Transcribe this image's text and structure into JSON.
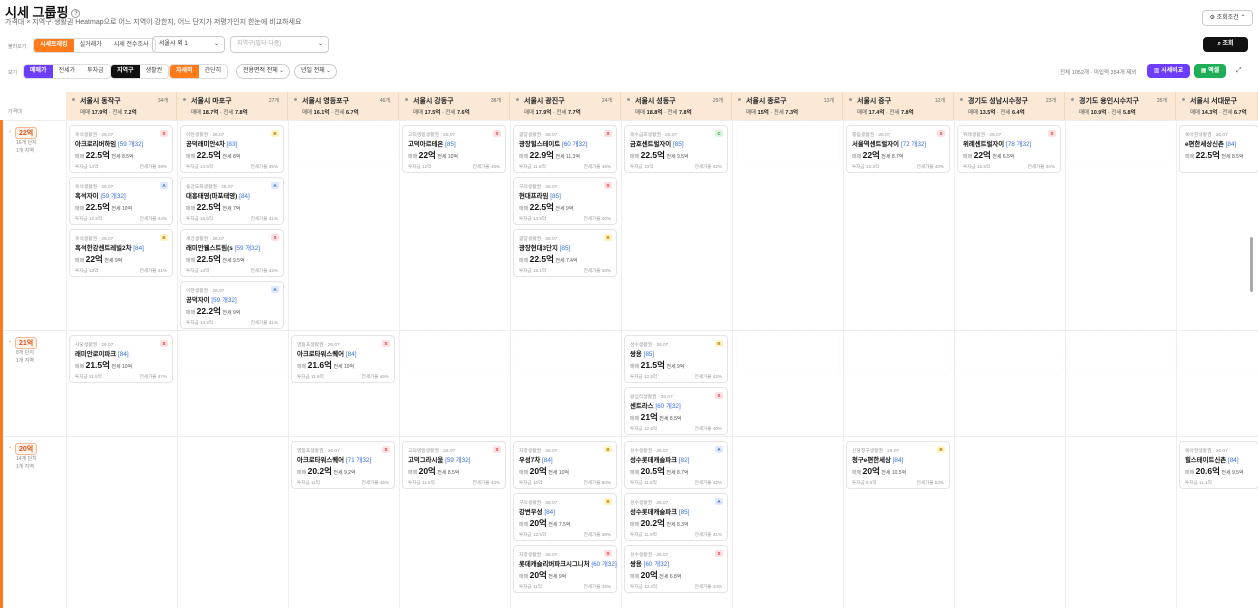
{
  "header": {
    "title": "시세 그룹핑",
    "subtitle": "가격대 × 지역구·생활권 Heatmap으로 어느 지역이 강한지, 어느 단지가 저평가인지 한눈에 비교하세요",
    "cond_button": "조회조건"
  },
  "filters": {
    "view_label": "불러오기",
    "mode_tabs": [
      "시세트래킹",
      "실거래가",
      "시세 전수조사"
    ],
    "region_select": "서울시 외 1",
    "district_placeholder": "지역구(필터 다중)",
    "search_button": "조회"
  },
  "viewbar": {
    "label": "보기",
    "price_tabs": [
      "매매가",
      "전세가",
      "투자금"
    ],
    "group_tabs": [
      "지역구",
      "생활권"
    ],
    "detail_tabs": [
      "자세히",
      "간단히"
    ],
    "area_select": "전용면적 전체",
    "year_select": "년일 전체",
    "summary": "전체 1052개 · 미입력 354개 제외",
    "compare_button": "시세비교",
    "excel_button": "엑셀"
  },
  "grid": {
    "corner_label": "가격대",
    "columns": [
      {
        "name": "서울시 동작구",
        "count": "34개",
        "sale": "17.9억",
        "jeonse": "7.2억"
      },
      {
        "name": "서울시 마포구",
        "count": "27개",
        "sale": "18.7억",
        "jeonse": "7.8억"
      },
      {
        "name": "서울시 영등포구",
        "count": "46개",
        "sale": "16.1억",
        "jeonse": "6.7억"
      },
      {
        "name": "서울시 강동구",
        "count": "38개",
        "sale": "17.5억",
        "jeonse": "7.6억"
      },
      {
        "name": "서울시 광진구",
        "count": "24개",
        "sale": "17.9억",
        "jeonse": "7.7억"
      },
      {
        "name": "서울시 성동구",
        "count": "29개",
        "sale": "18.8억",
        "jeonse": "7.8억"
      },
      {
        "name": "서울시 종로구",
        "count": "13개",
        "sale": "15억",
        "jeonse": "7.3억"
      },
      {
        "name": "서울시 중구",
        "count": "12개",
        "sale": "17.4억",
        "jeonse": "7.8억"
      },
      {
        "name": "경기도 성남시수정구",
        "count": "23개",
        "sale": "13.5억",
        "jeonse": "6.4억"
      },
      {
        "name": "경기도 용인시수지구",
        "count": "35개",
        "sale": "10.9억",
        "jeonse": "5.8억"
      },
      {
        "name": "서울시 서대문구",
        "count": "",
        "sale": "14.3억",
        "jeonse": "6.7억"
      }
    ],
    "sale_label": "매매",
    "jeonse_label": "전세",
    "rows": [
      {
        "price": "22억",
        "l1": "16개 단지",
        "l2": "1개 지역"
      },
      {
        "price": "21억",
        "l1": "8개 단지",
        "l2": "1개 지역"
      },
      {
        "price": "20억",
        "l1": "14개 단지",
        "l2": "1개 지역"
      }
    ]
  },
  "cards": [
    {
      "col": 0,
      "row": 0,
      "y": 0,
      "t": "흑석생활권 · 26.07",
      "g": "S",
      "nm": "아크로리버하임",
      "area": "[59 개32]",
      "sale": "22.5억",
      "je": "8.5억",
      "inv": "14억",
      "rate": "38%"
    },
    {
      "col": 0,
      "row": 0,
      "y": 1,
      "t": "흑석생활권 · 26.07",
      "g": "A",
      "nm": "흑석자이",
      "area": "[59 개32]",
      "sale": "22.5억",
      "je": "10억",
      "inv": "12.5억",
      "rate": "44%"
    },
    {
      "col": 0,
      "row": 0,
      "y": 2,
      "t": "흑석생활권 · 26.07",
      "g": "B",
      "nm": "흑석한강센트레빌2차",
      "area": "[84]",
      "sale": "22억",
      "je": "9억",
      "inv": "13억",
      "rate": "41%"
    },
    {
      "col": 1,
      "row": 0,
      "y": 0,
      "t": "아현생활권 · 26.07",
      "g": "B",
      "nm": "공덕래미안4차",
      "area": "[83]",
      "sale": "22.5억",
      "je": "8억",
      "inv": "14.5억",
      "rate": "36%"
    },
    {
      "col": 1,
      "row": 0,
      "y": 1,
      "t": "용강도화생활권 · 26.07",
      "g": "A",
      "nm": "대흥태영(마포태영)",
      "area": "[84]",
      "sale": "22.5억",
      "je": "7억",
      "inv": "15.5억",
      "rate": "31%"
    },
    {
      "col": 1,
      "row": 0,
      "y": 2,
      "t": "세강생활권 · 26.07",
      "g": "S",
      "nm": "래미안웰스트림(s",
      "area": "[59 개32]",
      "sale": "22.5억",
      "je": "9.5억",
      "inv": "13억",
      "rate": "42%"
    },
    {
      "col": 1,
      "row": 0,
      "y": 3,
      "t": "아현생활권 · 26.07",
      "g": "A",
      "nm": "공덕자이",
      "area": "[59 개32]",
      "sale": "22.2억",
      "je": "9억",
      "inv": "13.2억",
      "rate": "41%"
    },
    {
      "col": 3,
      "row": 0,
      "y": 0,
      "t": "고덕명일생활권 · 26.07",
      "g": "S",
      "nm": "고덕아르테온",
      "area": "[85]",
      "sale": "22억",
      "je": "10억",
      "inv": "12억",
      "rate": "45%"
    },
    {
      "col": 4,
      "row": 0,
      "y": 0,
      "t": "광장생활권 · 26.07",
      "g": "S",
      "nm": "광장힐스테이트",
      "area": "[60 개32]",
      "sale": "22.9억",
      "je": "11.3억",
      "inv": "11.6억",
      "rate": "49%"
    },
    {
      "col": 4,
      "row": 0,
      "y": 1,
      "t": "구의생활권 · 26.07",
      "g": "S",
      "nm": "현대프라임",
      "area": "[85]",
      "sale": "22.5억",
      "je": "9억",
      "inv": "13.5억",
      "rate": "40%"
    },
    {
      "col": 4,
      "row": 0,
      "y": 2,
      "t": "광장생활권 · 26.07",
      "g": "B",
      "nm": "광장현대3단지",
      "area": "[85]",
      "sale": "22.5억",
      "je": "7.4억",
      "inv": "15.1억",
      "rate": "33%"
    },
    {
      "col": 5,
      "row": 0,
      "y": 0,
      "t": "옥수금호생활권 · 26.07",
      "g": "C",
      "nm": "금호센트럴자이",
      "area": "[85]",
      "sale": "22.5억",
      "je": "9.5억",
      "inv": "13억",
      "rate": "42%"
    },
    {
      "col": 7,
      "row": 0,
      "y": 0,
      "t": "중림생활권 · 26.07",
      "g": "S",
      "nm": "서울역센트럴자이",
      "area": "[72 개32]",
      "sale": "22억",
      "je": "8.7억",
      "inv": "13.3억",
      "rate": "40%"
    },
    {
      "col": 8,
      "row": 0,
      "y": 0,
      "t": "위례생활권 · 26.07",
      "g": "S",
      "nm": "위례센트럴자이",
      "area": "[78 개32]",
      "sale": "22억",
      "je": "6.5억",
      "inv": "15.5억",
      "rate": "30%"
    },
    {
      "col": 10,
      "row": 0,
      "y": 0,
      "t": "북아현생활권 · 26.07",
      "g": "",
      "nm": "e편한세상신촌",
      "area": "[84]",
      "sale": "22.5억",
      "je": "8.5억",
      "inv": "",
      "rate": ""
    },
    {
      "col": 0,
      "row": 1,
      "y": 0,
      "t": "사당생활권 · 26.07",
      "g": "S",
      "nm": "래미안로이파크",
      "area": "[84]",
      "sale": "21.5억",
      "je": "10억",
      "inv": "11.5억",
      "rate": "47%"
    },
    {
      "col": 2,
      "row": 1,
      "y": 0,
      "t": "영등포생활권 · 26.07",
      "g": "S",
      "nm": "아크로타워스퀘어",
      "area": "[84]",
      "sale": "21.6억",
      "je": "10억",
      "inv": "11.6억",
      "rate": "46%"
    },
    {
      "col": 5,
      "row": 1,
      "y": 0,
      "t": "성수생활권 · 26.07",
      "g": "B",
      "nm": "쌍용",
      "area": "[85]",
      "sale": "21.5억",
      "je": "9억",
      "inv": "12.5억",
      "rate": "42%"
    },
    {
      "col": 5,
      "row": 1,
      "y": 1,
      "t": "왕십리생활권 · 26.07",
      "g": "S",
      "nm": "센트라스",
      "area": "[60 개32]",
      "sale": "21억",
      "je": "8.5억",
      "inv": "12.5억",
      "rate": "40%"
    },
    {
      "col": 2,
      "row": 2,
      "y": 0,
      "t": "영등포생활권 · 26.07",
      "g": "S",
      "nm": "아크로타워스퀘어",
      "area": "[71 개32]",
      "sale": "20.2억",
      "je": "9.2억",
      "inv": "11억",
      "rate": "46%"
    },
    {
      "col": 3,
      "row": 2,
      "y": 0,
      "t": "고덕명일생활권 · 26.07",
      "g": "S",
      "nm": "고덕그라시움",
      "area": "[59 개32]",
      "sale": "20억",
      "je": "8.5억",
      "inv": "11.5억",
      "rate": "43%"
    },
    {
      "col": 4,
      "row": 2,
      "y": 0,
      "t": "자양생활권 · 26.07",
      "g": "B",
      "nm": "우성7차",
      "area": "[84]",
      "sale": "20억",
      "je": "10억",
      "inv": "10억",
      "rate": "50%"
    },
    {
      "col": 4,
      "row": 2,
      "y": 1,
      "t": "구의생활권 · 26.07",
      "g": "B",
      "nm": "강변우성",
      "area": "[84]",
      "sale": "20억",
      "je": "7.5억",
      "inv": "12.5억",
      "rate": "38%"
    },
    {
      "col": 4,
      "row": 2,
      "y": 2,
      "t": "자양생활권 · 26.07",
      "g": "S",
      "nm": "롯데캐슬리버파크시그니처",
      "area": "[60 개32]",
      "sale": "20억",
      "je": "9억",
      "inv": "11억",
      "rate": "45%"
    },
    {
      "col": 5,
      "row": 2,
      "y": 0,
      "t": "성수생활권 · 26.07",
      "g": "A",
      "nm": "성수롯데캐슬파크",
      "area": "[82]",
      "sale": "20.5억",
      "je": "8.7억",
      "inv": "11.8억",
      "rate": "42%"
    },
    {
      "col": 5,
      "row": 2,
      "y": 1,
      "t": "성수생활권 · 26.07",
      "g": "A",
      "nm": "성수롯데캐슬파크",
      "area": "[85]",
      "sale": "20.2억",
      "je": "8.3억",
      "inv": "11.9억",
      "rate": "41%"
    },
    {
      "col": 5,
      "row": 2,
      "y": 2,
      "t": "성수생활권 · 26.07",
      "g": "S",
      "nm": "쌍용",
      "area": "[60 개32]",
      "sale": "20억",
      "je": "6.8억",
      "inv": "13.2억",
      "rate": "34%"
    },
    {
      "col": 7,
      "row": 2,
      "y": 0,
      "t": "신당청구생활권 · 26.07",
      "g": "B",
      "nm": "청구e편한세상",
      "area": "[84]",
      "sale": "20억",
      "je": "10.5억",
      "inv": "9.5억",
      "rate": "53%"
    },
    {
      "col": 10,
      "row": 2,
      "y": 0,
      "t": "북아현생활권 · 26.07",
      "g": "",
      "nm": "힐스테이트신촌",
      "area": "[84]",
      "sale": "20.6억",
      "je": "9.5억",
      "inv": "11.1억",
      "rate": ""
    }
  ],
  "card_labels": {
    "sale": "매매",
    "jeonse": "전세",
    "inv": "투자금",
    "rate": "전세가율"
  }
}
